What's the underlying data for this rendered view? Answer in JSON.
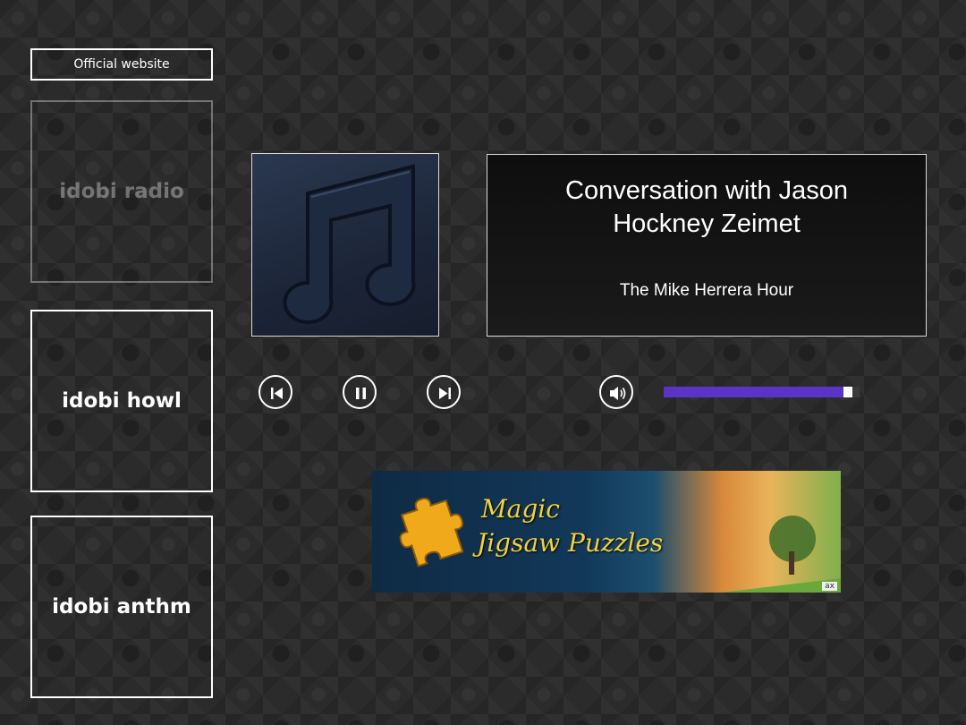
{
  "official_website_label": "Official website",
  "stations": [
    {
      "name": "idobi radio",
      "active": true
    },
    {
      "name": "idobi howl",
      "active": false
    },
    {
      "name": "idobi anthm",
      "active": false
    }
  ],
  "now_playing": {
    "title": "Conversation with Jason Hockney Zeimet",
    "show": "The Mike Herrera Hour",
    "album_art_icon": "music-note-icon"
  },
  "controls": {
    "previous_icon": "skip-previous-icon",
    "pause_icon": "pause-icon",
    "next_icon": "skip-next-icon",
    "volume_icon": "speaker-icon"
  },
  "volume_level": 0.96,
  "colors": {
    "accent": "#5a33c7"
  },
  "ad": {
    "line1": "Magic",
    "line2": "Jigsaw Puzzles",
    "badge": "ax"
  }
}
